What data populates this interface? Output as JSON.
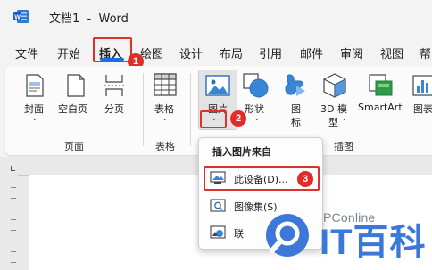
{
  "window": {
    "title": "文档1  -  Word",
    "app_icon": "word-logo-icon"
  },
  "menu": {
    "tabs": [
      {
        "label": "文件"
      },
      {
        "label": "开始"
      },
      {
        "label": "插入",
        "active": true
      },
      {
        "label": "绘图"
      },
      {
        "label": "设计"
      },
      {
        "label": "布局"
      },
      {
        "label": "引用"
      },
      {
        "label": "邮件"
      },
      {
        "label": "审阅"
      },
      {
        "label": "视图"
      },
      {
        "label": "帮"
      }
    ]
  },
  "ribbon": {
    "groups": {
      "pages": {
        "label": "页面",
        "buttons": [
          {
            "label": "封面",
            "icon": "cover-page-icon"
          },
          {
            "label": "空白页",
            "icon": "blank-page-icon"
          },
          {
            "label": "分页",
            "icon": "page-break-icon"
          }
        ]
      },
      "tables": {
        "label": "表格",
        "buttons": [
          {
            "label": "表格",
            "icon": "table-icon"
          }
        ]
      },
      "illustrations": {
        "label": "插图",
        "buttons": [
          {
            "label": "图片",
            "icon": "picture-icon"
          },
          {
            "label": "形状",
            "icon": "shapes-icon"
          },
          {
            "label": "图",
            "label_line2": "标",
            "icon": "icons-icon"
          },
          {
            "label": "3D 模",
            "label_line2": "型",
            "icon": "3d-model-icon"
          },
          {
            "label": "SmartArt",
            "icon": "smartart-icon"
          },
          {
            "label": "图表",
            "icon": "chart-icon"
          }
        ]
      }
    }
  },
  "dropdown": {
    "header": "插入图片来自",
    "items": [
      {
        "label": "此设备(D)...",
        "icon": "this-device-icon"
      },
      {
        "label": "图像集(S)",
        "icon": "image-set-icon"
      },
      {
        "label": "联",
        "icon": "online-pictures-icon"
      }
    ]
  },
  "annotations": {
    "step1": "1",
    "step2": "2",
    "step3": "3"
  },
  "watermark": {
    "site": "PConline",
    "brand": "IT百科"
  },
  "colors": {
    "accent_blue": "#1a6ee0",
    "highlight_red": "#e0302a",
    "badge_red": "#e12c27",
    "watermark_blue": "#3b78d8"
  }
}
